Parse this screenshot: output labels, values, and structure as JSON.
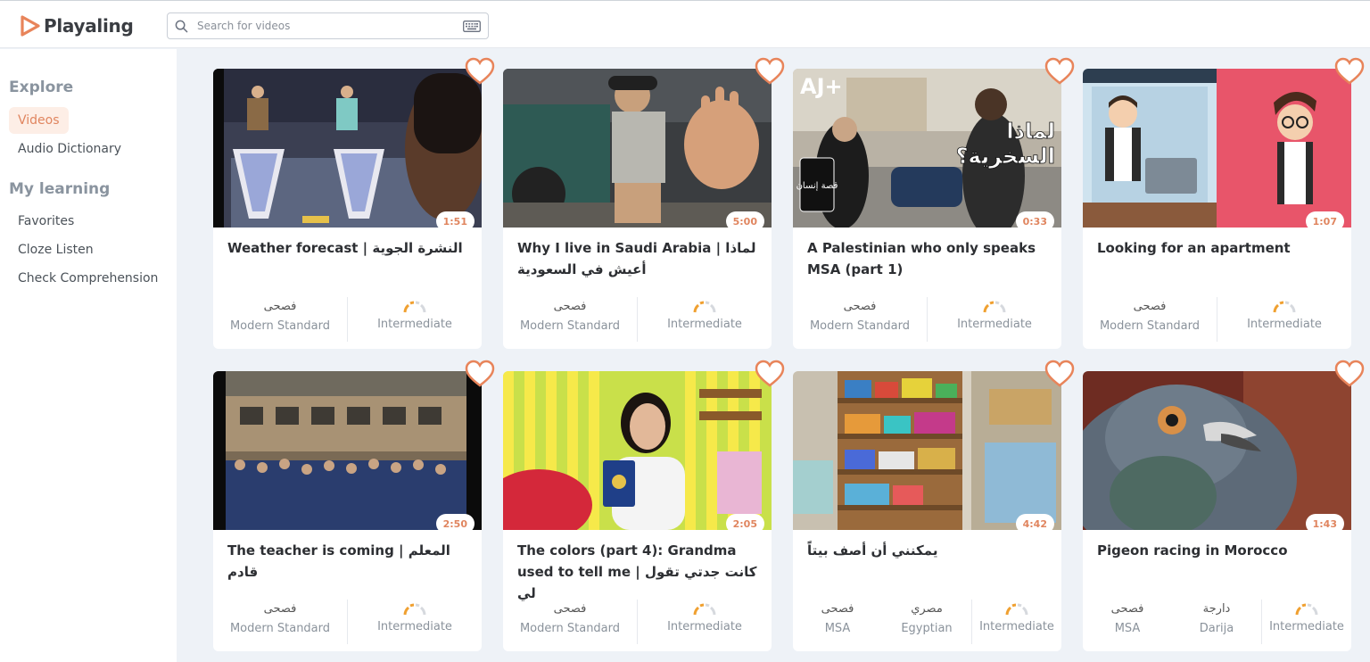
{
  "app": {
    "name": "Playaling",
    "brand_color": "#e8845a"
  },
  "search": {
    "placeholder": "Search for videos",
    "icon": "search-icon",
    "keyboard_icon": "keyboard-icon"
  },
  "sidebar": {
    "explore_heading": "Explore",
    "explore_items": [
      {
        "label": "Videos",
        "active": true
      },
      {
        "label": "Audio Dictionary",
        "active": false
      }
    ],
    "learning_heading": "My learning",
    "learning_items": [
      {
        "label": "Favorites"
      },
      {
        "label": "Cloze Listen"
      },
      {
        "label": "Check Comprehension"
      }
    ]
  },
  "videos": [
    {
      "title": "Weather forecast | النشرة الجوية",
      "duration": "1:51",
      "dialects": [
        {
          "ar": "فصحى",
          "en": "Modern Standard"
        }
      ],
      "level": "Intermediate"
    },
    {
      "title": "Why I live in Saudi Arabia | لماذا أعيش في السعودية",
      "duration": "5:00",
      "dialects": [
        {
          "ar": "فصحى",
          "en": "Modern Standard"
        }
      ],
      "level": "Intermediate"
    },
    {
      "title": "A Palestinian who only speaks MSA (part 1)",
      "duration": "0:33",
      "dialects": [
        {
          "ar": "فصحى",
          "en": "Modern Standard"
        }
      ],
      "level": "Intermediate",
      "overlay_text_1": "لماذا",
      "overlay_text_2": "السخرية؟",
      "logo_text": "AJ+",
      "badge_text": "قصة إنسان"
    },
    {
      "title": "Looking for an apartment",
      "duration": "1:07",
      "dialects": [
        {
          "ar": "فصحى",
          "en": "Modern Standard"
        }
      ],
      "level": "Intermediate"
    },
    {
      "title": "The teacher is coming | المعلم قادم",
      "duration": "2:50",
      "dialects": [
        {
          "ar": "فصحى",
          "en": "Modern Standard"
        }
      ],
      "level": "Intermediate"
    },
    {
      "title": "The colors (part 4): Grandma used to tell me | كانت جدتي تقول لي",
      "duration": "2:05",
      "dialects": [
        {
          "ar": "فصحى",
          "en": "Modern Standard"
        }
      ],
      "level": "Intermediate"
    },
    {
      "title": "يمكنني أن أصف بيتاً",
      "duration": "4:42",
      "dialects": [
        {
          "ar": "فصحى",
          "en": "MSA"
        },
        {
          "ar": "مصري",
          "en": "Egyptian"
        }
      ],
      "level": "Intermediate"
    },
    {
      "title": "Pigeon racing in Morocco",
      "duration": "1:43",
      "dialects": [
        {
          "ar": "فصحى",
          "en": "MSA"
        },
        {
          "ar": "دارجة",
          "en": "Darija"
        }
      ],
      "level": "Intermediate"
    }
  ]
}
